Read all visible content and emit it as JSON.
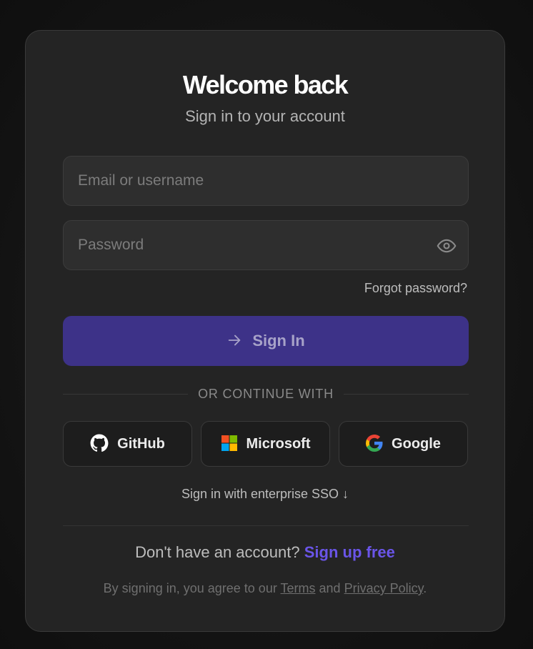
{
  "header": {
    "title": "Welcome back",
    "subtitle": "Sign in to your account"
  },
  "form": {
    "email_placeholder": "Email or username",
    "email_value": "",
    "password_placeholder": "Password",
    "password_value": "",
    "forgot_label": "Forgot password?",
    "submit_label": "Sign In"
  },
  "divider": {
    "label": "OR CONTINUE WITH"
  },
  "social": {
    "github": "GitHub",
    "microsoft": "Microsoft",
    "google": "Google"
  },
  "sso": {
    "label": "Sign in with enterprise SSO ↓"
  },
  "signup": {
    "question": "Don't have an account?",
    "link": "Sign up free"
  },
  "legal": {
    "prefix": "By signing in, you agree to our",
    "terms": "Terms",
    "and": "and",
    "privacy": "Privacy Policy",
    "suffix": "."
  },
  "colors": {
    "accent": "#6a55e8",
    "button": "#3d3288",
    "card": "#242424",
    "background": "#151515"
  }
}
